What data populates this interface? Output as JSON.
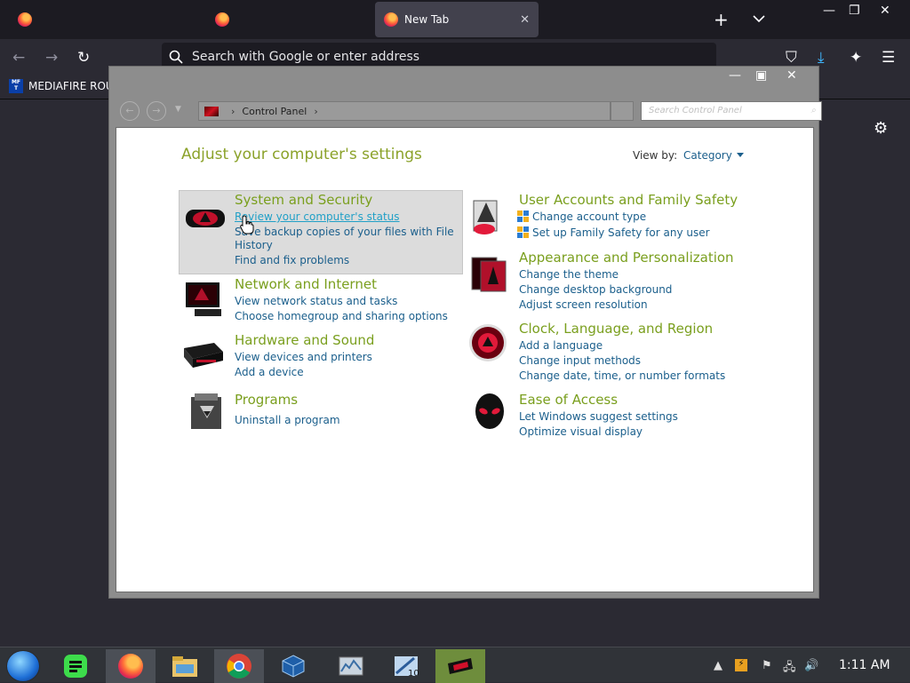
{
  "browser": {
    "tabs": [
      {
        "label": "",
        "active": false
      },
      {
        "label": "",
        "active": false
      },
      {
        "label": "New Tab",
        "active": true
      }
    ],
    "url_placeholder": "Search with Google or enter address",
    "bookmark": {
      "badge": "MF T",
      "label": "MEDIAFIRE ROUL"
    }
  },
  "control_panel": {
    "breadcrumb": "Control Panel",
    "search_placeholder": "Search Control Panel",
    "heading": "Adjust your computer's settings",
    "view_by_label": "View by:",
    "view_by_value": "Category",
    "categories": [
      {
        "title": "System and Security",
        "links": [
          "Review your computer's status",
          "Save backup copies of your files with File",
          "History",
          "Find and fix problems"
        ]
      },
      {
        "title": "Network and Internet",
        "links": [
          "View network status and tasks",
          "Choose homegroup and sharing options"
        ]
      },
      {
        "title": "Hardware and Sound",
        "links": [
          "View devices and printers",
          "Add a device"
        ]
      },
      {
        "title": "Programs",
        "links": [
          "Uninstall a program"
        ]
      },
      {
        "title": "User Accounts and Family Safety",
        "links": [
          "Change account type",
          "Set up Family Safety for any user"
        ]
      },
      {
        "title": "Appearance and Personalization",
        "links": [
          "Change the theme",
          "Change desktop background",
          "Adjust screen resolution"
        ]
      },
      {
        "title": "Clock, Language, and Region",
        "links": [
          "Add a language",
          "Change input methods",
          "Change date, time, or number formats"
        ]
      },
      {
        "title": "Ease of Access",
        "links": [
          "Let Windows suggest settings",
          "Optimize visual display"
        ]
      }
    ]
  },
  "taskbar": {
    "clock": "1:11 AM",
    "accent": "#6e8d3c"
  }
}
